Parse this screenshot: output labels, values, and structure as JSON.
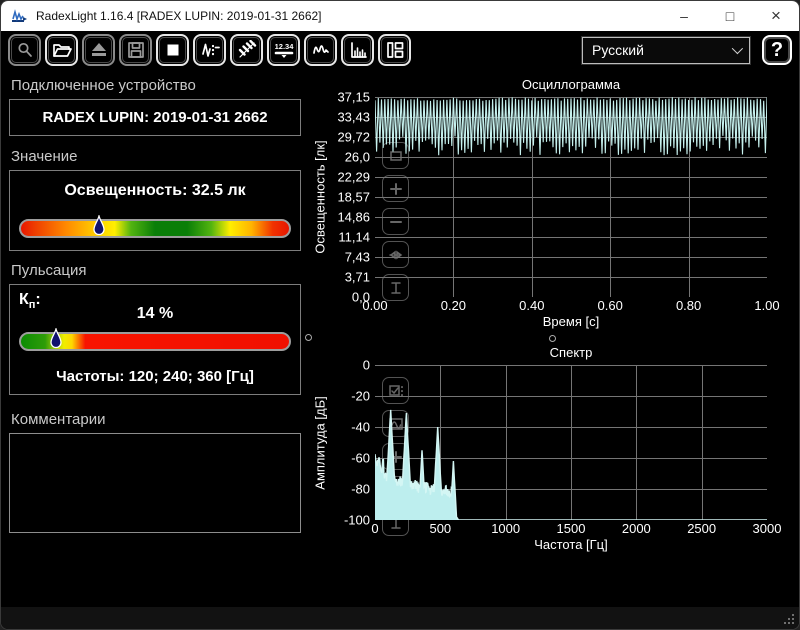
{
  "window": {
    "title": "RadexLight 1.16.4 [RADEX LUPIN: 2019-01-31 2662]"
  },
  "titlebar": {
    "minimize": "–",
    "maximize": "□",
    "close": "×"
  },
  "toolbar": {
    "buttons": [
      {
        "name": "zoom-tool",
        "disabled": true
      },
      {
        "name": "open-file",
        "disabled": false
      },
      {
        "name": "eject-device",
        "disabled": true
      },
      {
        "name": "save-file",
        "disabled": true
      },
      {
        "name": "stop-measurement",
        "disabled": false
      },
      {
        "name": "pulse-settings",
        "disabled": false
      },
      {
        "name": "flicker-settings",
        "disabled": false
      },
      {
        "name": "numeric-display",
        "disabled": false
      },
      {
        "name": "oscillogram-view",
        "disabled": false
      },
      {
        "name": "spectrum-view",
        "disabled": false
      },
      {
        "name": "layout-panels",
        "disabled": false
      }
    ],
    "numeric_icon_text": "12.34",
    "language": {
      "value": "Русский"
    },
    "help_label": "?"
  },
  "device_section": {
    "label": "Подключенное устройство",
    "device": "RADEX LUPIN: 2019-01-31 2662"
  },
  "value_section": {
    "label": "Значение",
    "reading": "Освещенность: 32.5 лк",
    "marker_position": 0.295,
    "bar_stops": [
      "#e81600 0%",
      "#ee3c00 5%",
      "#ff8a00 17%",
      "#ffc800 27%",
      "#ffee00 35%",
      "#53b410 41%",
      "#0a7e08 50%",
      "#0a7e08 62%",
      "#53b410 71%",
      "#ffee00 78%",
      "#ffb400 86%",
      "#f03200 94%",
      "#e81600 100%"
    ]
  },
  "pulsation_section": {
    "label": "Пульсация",
    "kp_main": "К",
    "kp_sub": "п",
    "kp_suffix": ":",
    "kp_value": "14 %",
    "frequencies": "Частоты: 120; 240; 360 [Гц]",
    "marker_position": 0.135,
    "bar_stops": [
      "#0c8c04 0%",
      "#2e9c08 9%",
      "#a8cc0a 13%",
      "#f0ee00 16%",
      "#ffd800 19%",
      "#f81400 24%",
      "#f01000 100%"
    ]
  },
  "comments_section": {
    "label": "Комментарии",
    "value": ""
  },
  "chart_data": [
    {
      "type": "line",
      "title": "Осциллограмма",
      "xlabel": "Время [с]",
      "ylabel": "Освещенность [лк]",
      "xlim": [
        0,
        1
      ],
      "ylim": [
        0,
        37.15
      ],
      "grid": true,
      "color": "#c6f1ee",
      "grid_color": "#757575",
      "xticks": [
        "0.00",
        "0.20",
        "0.40",
        "0.60",
        "0.80",
        "1.00"
      ],
      "yticks": [
        "37,15",
        "33,43",
        "29,72",
        "26,0",
        "22,29",
        "18,57",
        "14,86",
        "11,14",
        "7,43",
        "3,71",
        "0,0"
      ],
      "waveform": {
        "description": "rectified flicker waveform, 120 cycles over 1 s",
        "frequency_hz": 120,
        "duration_s": 1,
        "top_lux_min": 36.4,
        "top_lux_max": 37.1,
        "bottom_lux_min": 26.3,
        "bottom_lux_max": 30.0,
        "mean_lux": 32.5
      },
      "tools": [
        "zoom-box",
        "zoom-in",
        "zoom-out",
        "fit-width",
        "fit-height"
      ]
    },
    {
      "type": "area",
      "title": "Спектр",
      "xlabel": "Частота [Гц]",
      "ylabel": "Амплитуда [дБ]",
      "xlim": [
        0,
        3000
      ],
      "ylim": [
        -100,
        0
      ],
      "grid": true,
      "color": "#bdeeee",
      "grid_color": "#757575",
      "xticks": [
        "0",
        "500",
        "1000",
        "1500",
        "2000",
        "2500",
        "3000"
      ],
      "yticks": [
        "0",
        "-20",
        "-40",
        "-60",
        "-80",
        "-100"
      ],
      "noise_floor_db": [
        [
          0,
          -60
        ],
        [
          15,
          -66
        ],
        [
          30,
          -58
        ],
        [
          45,
          -70
        ],
        [
          60,
          -62
        ],
        [
          80,
          -74
        ],
        [
          100,
          -72
        ],
        [
          140,
          -74
        ],
        [
          180,
          -76
        ],
        [
          220,
          -74
        ],
        [
          260,
          -78
        ],
        [
          300,
          -77
        ],
        [
          340,
          -80
        ],
        [
          380,
          -78
        ],
        [
          420,
          -80
        ],
        [
          460,
          -79
        ],
        [
          500,
          -82
        ],
        [
          540,
          -80
        ],
        [
          570,
          -84
        ],
        [
          600,
          -80
        ],
        [
          615,
          -90
        ],
        [
          625,
          -100
        ],
        [
          3000,
          -100
        ]
      ],
      "peaks_hz_db": [
        [
          30,
          -57
        ],
        [
          60,
          -61
        ],
        [
          120,
          -29
        ],
        [
          240,
          -31
        ],
        [
          360,
          -55
        ],
        [
          480,
          -40
        ],
        [
          600,
          -62
        ]
      ],
      "tools": [
        "auto-scale",
        "curve-mode",
        "zoom-in",
        "zoom-out",
        "fit-height"
      ]
    }
  ]
}
